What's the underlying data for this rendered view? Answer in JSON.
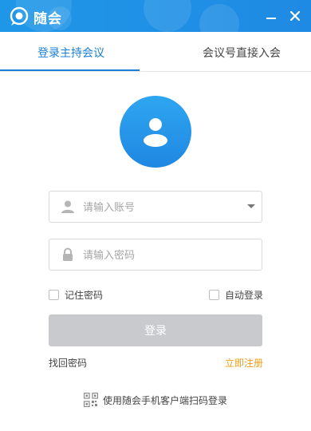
{
  "window": {
    "title": "随会",
    "accent_color": "#1f8fe5",
    "minimize_icon": "minimize-icon",
    "close_icon": "close-icon"
  },
  "tabs": [
    {
      "label": "登录主持会议",
      "active": true
    },
    {
      "label": "会议号直接入会",
      "active": false
    }
  ],
  "form": {
    "account_placeholder": "请输入账号",
    "password_placeholder": "请输入密码",
    "remember_label": "记住密码",
    "remember_checked": false,
    "auto_login_label": "自动登录",
    "auto_login_checked": false,
    "login_button": "登录",
    "forgot_link": "找回密码",
    "register_link": "立即注册",
    "register_color": "#f39c12",
    "qr_login_label": "使用随会手机客户端扫码登录"
  }
}
